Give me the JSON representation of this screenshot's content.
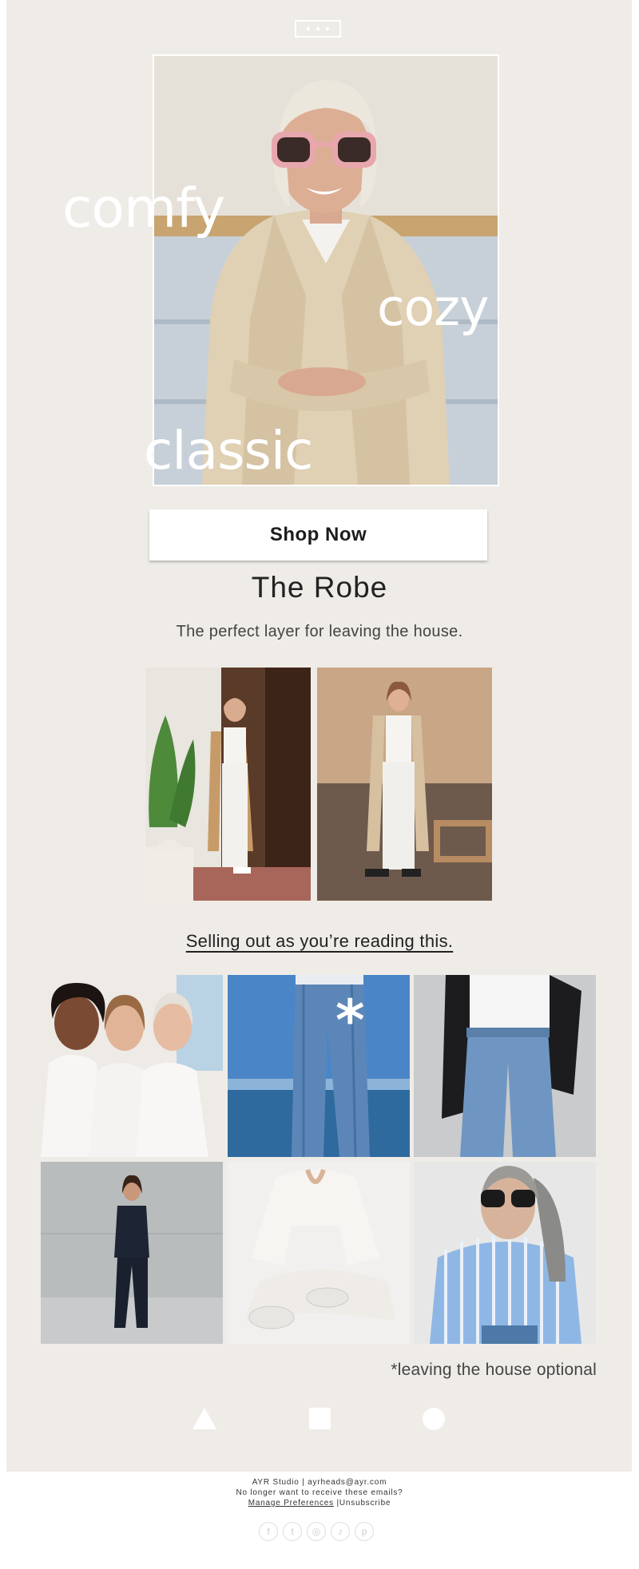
{
  "hero": {
    "words": [
      "comfy",
      "cozy",
      "classic"
    ]
  },
  "cta": {
    "shop_label": "Shop Now"
  },
  "product": {
    "title": "The Robe",
    "subtitle": "The perfect layer for leaving the house."
  },
  "selling": {
    "link_text": "Selling out as you’re reading this."
  },
  "grid": {
    "asterisk": "*"
  },
  "note": "*leaving the house optional",
  "shapes": [
    "triangle-icon",
    "square-icon",
    "circle-icon"
  ],
  "footer": {
    "line1": "AYR Studio | ayrheads@ayr.com",
    "line2": "No longer want to receive these emails?",
    "manage": "Manage Preferences",
    "separator": " |",
    "unsubscribe": "Unsubscribe"
  },
  "social": [
    {
      "name": "facebook-icon",
      "glyph": "f"
    },
    {
      "name": "tumblr-icon",
      "glyph": "t"
    },
    {
      "name": "instagram-icon",
      "glyph": "◎"
    },
    {
      "name": "twitter-icon",
      "glyph": "♪"
    },
    {
      "name": "pinterest-icon",
      "glyph": "p"
    }
  ],
  "colors": {
    "panel_bg": "#efece8",
    "text_dark": "#222222",
    "white": "#ffffff"
  }
}
